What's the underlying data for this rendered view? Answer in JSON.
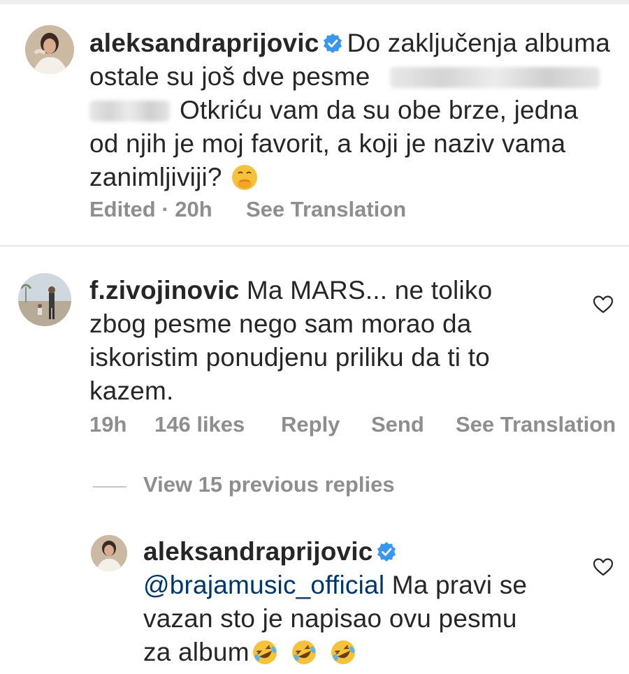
{
  "comments": [
    {
      "username": "aleksandraprijovic",
      "verified": true,
      "text_line1": "Do zaključenja albuma",
      "text_line2": "ostale su još dve pesme",
      "text_line3": "Otkriću vam da su obe brze, jedna",
      "text_line4": "od njih je moj favorit, a koji je naziv vama",
      "text_line5": "zanimljiviji?",
      "emoji": "face-with-hand-over-mouth-emoji",
      "edited": "Edited · 20h",
      "see_translation": "See Translation"
    },
    {
      "username": "f.zivojinovic",
      "verified": false,
      "text_line1": "Ma MARS... ne toliko",
      "text_line2": "zbog pesme nego sam morao da",
      "text_line3": "iskoristim ponudjenu priliku da ti to",
      "text_line4": "kazem.",
      "time": "19h",
      "likes": "146 likes",
      "reply": "Reply",
      "send": "Send",
      "see_translation": "See Translation"
    }
  ],
  "view_replies": "View 15 previous replies",
  "reply": {
    "username": "aleksandraprijovic",
    "verified": true,
    "mention": "@brajamusic_official",
    "text_line1": "Ma pravi se",
    "text_line2": "vazan sto je napisao ovu pesmu",
    "text_line3": "za album",
    "emojis": [
      "rolling-on-floor-laughing-emoji",
      "rolling-on-floor-laughing-emoji",
      "rolling-on-floor-laughing-emoji"
    ]
  },
  "colors": {
    "text": "#262626",
    "secondary": "#8e8e8e",
    "verified_blue": "#3897f0",
    "mention": "#00376b"
  }
}
